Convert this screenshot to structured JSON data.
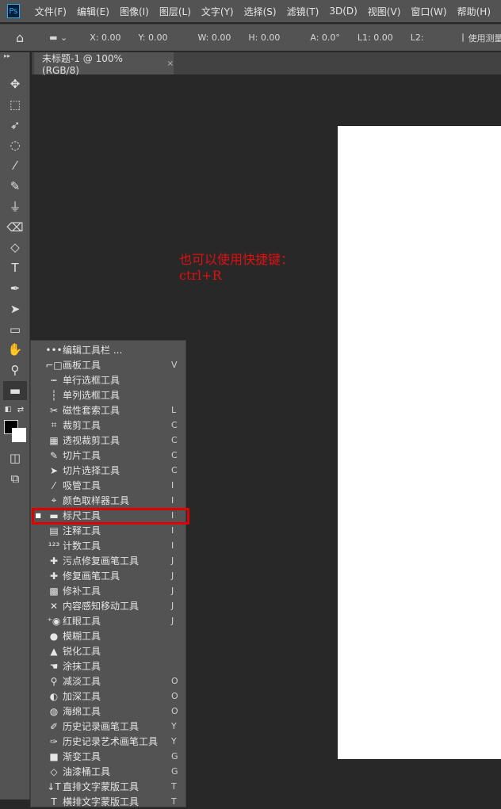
{
  "app": {
    "logo": "Ps"
  },
  "menu": [
    "文件(F)",
    "编辑(E)",
    "图像(I)",
    "图层(L)",
    "文字(Y)",
    "选择(S)",
    "滤镜(T)",
    "3D(D)",
    "视图(V)",
    "窗口(W)",
    "帮助(H)"
  ],
  "options": {
    "x": "X: 0.00",
    "y": "Y: 0.00",
    "w": "W:  0.00",
    "h": "H: 0.00",
    "a": "A: 0.0°",
    "l1": "L1: 0.00",
    "l2": "L2:",
    "use_measure": "使用测量"
  },
  "tab": {
    "title": "未标题-1 @ 100%(RGB/8)",
    "close": "×"
  },
  "note": {
    "line1": "也可以使用快捷键：",
    "line2": "ctrl+R",
    "color": "#e01010"
  },
  "flyout": [
    {
      "icon": "•••",
      "label": "编辑工具栏 ...",
      "key": ""
    },
    {
      "icon": "⌐□",
      "label": "画板工具",
      "key": "V"
    },
    {
      "icon": "┅",
      "label": "单行选框工具",
      "key": ""
    },
    {
      "icon": "┆",
      "label": "单列选框工具",
      "key": ""
    },
    {
      "icon": "✂",
      "label": "磁性套索工具",
      "key": "L"
    },
    {
      "icon": "⌗",
      "label": "裁剪工具",
      "key": "C"
    },
    {
      "icon": "▦",
      "label": "透视裁剪工具",
      "key": "C"
    },
    {
      "icon": "✎",
      "label": "切片工具",
      "key": "C"
    },
    {
      "icon": "➤",
      "label": "切片选择工具",
      "key": "C"
    },
    {
      "icon": "⁄",
      "label": "吸管工具",
      "key": "I"
    },
    {
      "icon": "⌖",
      "label": "颜色取样器工具",
      "key": "I"
    },
    {
      "icon": "▬",
      "label": "标尺工具",
      "key": "I",
      "selected": true
    },
    {
      "icon": "▤",
      "label": "注释工具",
      "key": "I"
    },
    {
      "icon": "¹²³",
      "label": "计数工具",
      "key": "I"
    },
    {
      "icon": "✚",
      "label": "污点修复画笔工具",
      "key": "J"
    },
    {
      "icon": "✚",
      "label": "修复画笔工具",
      "key": "J"
    },
    {
      "icon": "▩",
      "label": "修补工具",
      "key": "J"
    },
    {
      "icon": "✕",
      "label": "内容感知移动工具",
      "key": "J"
    },
    {
      "icon": "⁺◉",
      "label": "红眼工具",
      "key": "J"
    },
    {
      "icon": "●",
      "label": "模糊工具",
      "key": ""
    },
    {
      "icon": "▲",
      "label": "锐化工具",
      "key": ""
    },
    {
      "icon": "☚",
      "label": "涂抹工具",
      "key": ""
    },
    {
      "icon": "⚲",
      "label": "减淡工具",
      "key": "O"
    },
    {
      "icon": "◐",
      "label": "加深工具",
      "key": "O"
    },
    {
      "icon": "◍",
      "label": "海绵工具",
      "key": "O"
    },
    {
      "icon": "✐",
      "label": "历史记录画笔工具",
      "key": "Y"
    },
    {
      "icon": "✑",
      "label": "历史记录艺术画笔工具",
      "key": "Y"
    },
    {
      "icon": "■",
      "label": "渐变工具",
      "key": "G"
    },
    {
      "icon": "◇",
      "label": "油漆桶工具",
      "key": "G"
    },
    {
      "icon": "↓T",
      "label": "直排文字蒙版工具",
      "key": "T"
    },
    {
      "icon": "T",
      "label": "横排文字蒙版工具",
      "key": "T"
    }
  ],
  "tools": [
    {
      "name": "move-tool",
      "icon": "✥"
    },
    {
      "name": "marquee-tool",
      "icon": "⬚"
    },
    {
      "name": "lasso-tool",
      "icon": "➶"
    },
    {
      "name": "quick-select-tool",
      "icon": "◌"
    },
    {
      "name": "eyedropper-tool",
      "icon": "⁄"
    },
    {
      "name": "brush-tool",
      "icon": "✎"
    },
    {
      "name": "stamp-tool",
      "icon": "⏚"
    },
    {
      "name": "eraser-tool",
      "icon": "⌫"
    },
    {
      "name": "paint-bucket-tool",
      "icon": "◇"
    },
    {
      "name": "type-tool",
      "icon": "T"
    },
    {
      "name": "pen-tool",
      "icon": "✒"
    },
    {
      "name": "path-select-tool",
      "icon": "➤"
    },
    {
      "name": "rectangle-tool",
      "icon": "▭"
    },
    {
      "name": "hand-tool",
      "icon": "✋"
    },
    {
      "name": "zoom-tool",
      "icon": "⚲"
    },
    {
      "name": "ruler-tool",
      "icon": "▬"
    }
  ],
  "colors": {
    "foreground": "#000000",
    "background": "#ffffff",
    "highlight": "#e00000"
  }
}
